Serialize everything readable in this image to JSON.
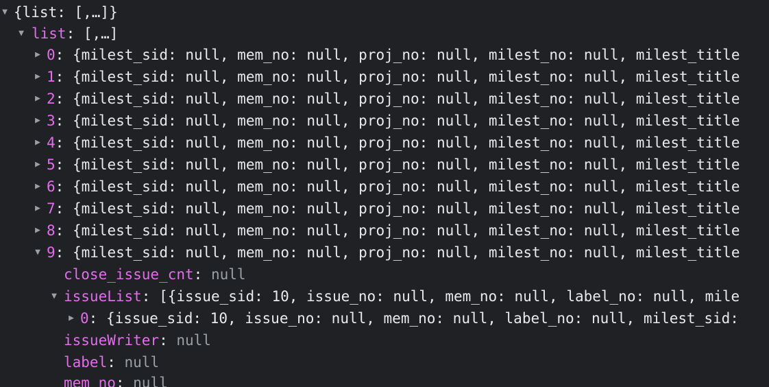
{
  "root": {
    "summary": "{list: [,…]}",
    "expanded": true
  },
  "list": {
    "key": "list",
    "summary": "[,…]",
    "expanded": true
  },
  "items": [
    {
      "key": "0",
      "summary": "{milest_sid: null, mem_no: null, proj_no: null, milest_no: null, milest_title",
      "expanded": false
    },
    {
      "key": "1",
      "summary": "{milest_sid: null, mem_no: null, proj_no: null, milest_no: null, milest_title",
      "expanded": false
    },
    {
      "key": "2",
      "summary": "{milest_sid: null, mem_no: null, proj_no: null, milest_no: null, milest_title",
      "expanded": false
    },
    {
      "key": "3",
      "summary": "{milest_sid: null, mem_no: null, proj_no: null, milest_no: null, milest_title",
      "expanded": false
    },
    {
      "key": "4",
      "summary": "{milest_sid: null, mem_no: null, proj_no: null, milest_no: null, milest_title",
      "expanded": false
    },
    {
      "key": "5",
      "summary": "{milest_sid: null, mem_no: null, proj_no: null, milest_no: null, milest_title",
      "expanded": false
    },
    {
      "key": "6",
      "summary": "{milest_sid: null, mem_no: null, proj_no: null, milest_no: null, milest_title",
      "expanded": false
    },
    {
      "key": "7",
      "summary": "{milest_sid: null, mem_no: null, proj_no: null, milest_no: null, milest_title",
      "expanded": false
    },
    {
      "key": "8",
      "summary": "{milest_sid: null, mem_no: null, proj_no: null, milest_no: null, milest_title",
      "expanded": false
    },
    {
      "key": "9",
      "summary": "{milest_sid: null, mem_no: null, proj_no: null, milest_no: null, milest_title",
      "expanded": true
    }
  ],
  "item9": {
    "close_issue_cnt": {
      "key": "close_issue_cnt",
      "value": "null"
    },
    "issueList": {
      "key": "issueList",
      "summary": "[{issue_sid: 10, issue_no: null, mem_no: null, label_no: null, mile",
      "expanded": true,
      "child": {
        "key": "0",
        "summary": "{issue_sid: 10, issue_no: null, mem_no: null, label_no: null, milest_sid:",
        "expanded": false
      }
    },
    "issueWriter": {
      "key": "issueWriter",
      "value": "null"
    },
    "label": {
      "key": "label",
      "value": "null"
    },
    "mem_no": {
      "key": "mem_no",
      "value": "null"
    }
  },
  "colors": {
    "background": "#202124",
    "key": "#e36eec",
    "text": "#e8eaed",
    "null": "#9aa0a6",
    "toggle": "#9aa0a6"
  },
  "icons": {
    "expanded": "triangle-down-icon",
    "collapsed": "triangle-right-icon"
  }
}
